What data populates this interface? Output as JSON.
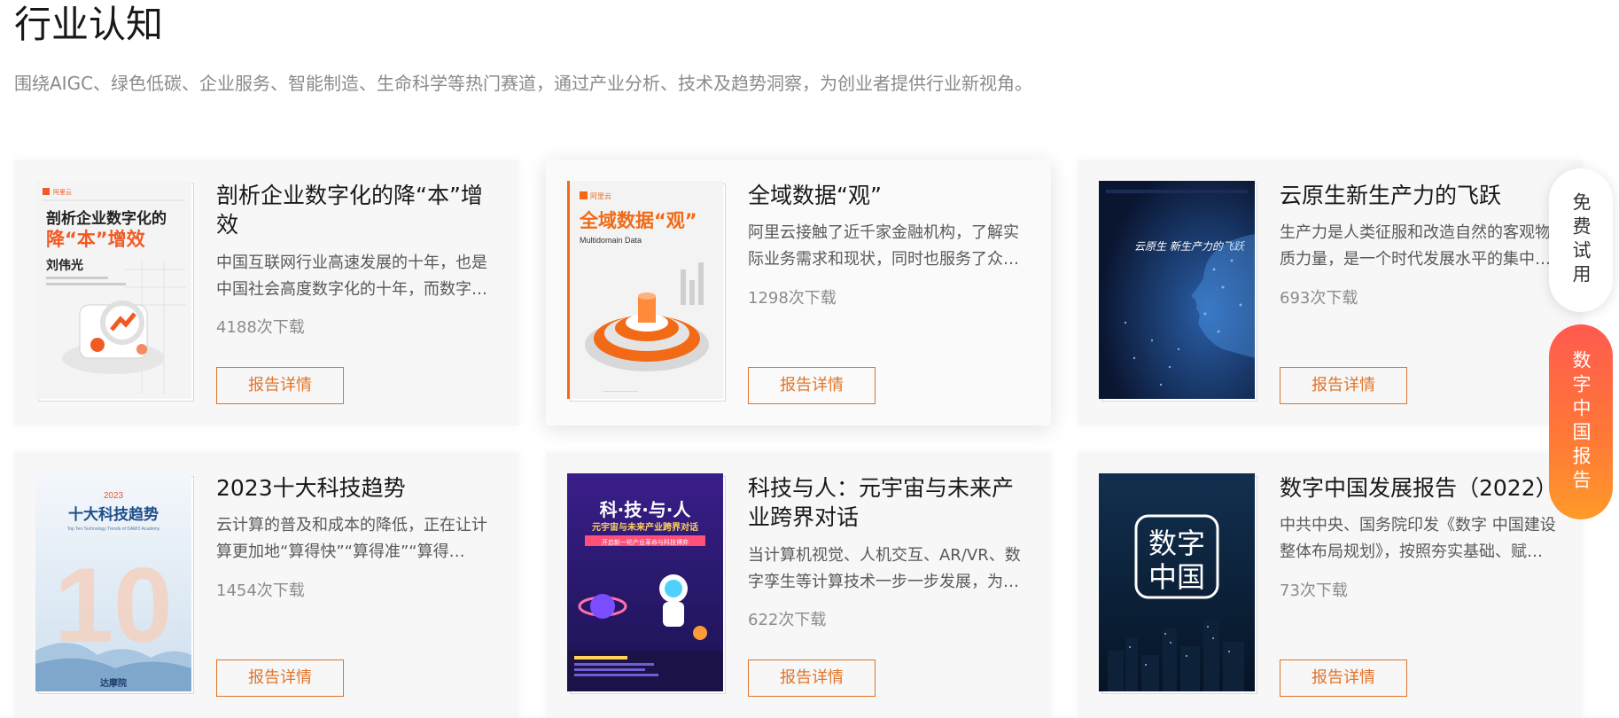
{
  "header": {
    "title": "行业认知",
    "subtitle": "围绕AIGC、绿色低碳、企业服务、智能制造、生命科学等热门赛道，通过产业分析、技术及趋势洞察，为创业者提供行业新视角。"
  },
  "cards": [
    {
      "title": "剖析企业数字化的降“本”增效",
      "desc": "中国互联网行业高速发展的十年，也是中国社会高度数字化的十年，而数字…",
      "downloads": "4188次下载",
      "button": "报告详情",
      "cover": {
        "logo": "阿里云",
        "line1": "剖析企业数字化的",
        "line2": "降“本”增效",
        "author": "刘伟光",
        "theme": "#f15a24"
      }
    },
    {
      "title": "全域数据“观”",
      "desc": "阿里云接触了近千家金融机构，了解实际业务需求和现状，同时也服务了众…",
      "downloads": "1298次下载",
      "button": "报告详情",
      "cover": {
        "logo": "阿里云",
        "headline": "全域数据“观”",
        "sub": "Multidomain Data",
        "theme": "#f26a16"
      }
    },
    {
      "title": "云原生新生产力的飞跃",
      "desc": "生产力是人类征服和改造自然的客观物质力量，是一个时代发展水平的集中…",
      "downloads": "693次下载",
      "button": "报告详情",
      "cover": {
        "headline": "云原生 新生产力的飞跃",
        "theme": "#0d1b3d"
      }
    },
    {
      "title": "2023十大科技趋势",
      "desc": "云计算的普及和成本的降低，正在让计算更加地“算得快”“算得准”“算得好”，…",
      "downloads": "1454次下载",
      "button": "报告详情",
      "cover": {
        "year": "2023",
        "headline": "十大科技趋势",
        "sub": "Top Ten Technology Trends of DAMO Academy",
        "number": "10",
        "brand": "达摩院",
        "theme": "#d9e6f2"
      }
    },
    {
      "title": "科技与人：元宇宙与未来产业跨界对话",
      "desc": "当计算机视觉、人机交互、AR/VR、数字孪生等计算技术一步一步发展，为…",
      "downloads": "622次下载",
      "button": "报告详情",
      "cover": {
        "headline": "科·技·与·人",
        "sub": "元宇宙与未来产业跨界对话",
        "tag": "开启新一轮产业革命与科技博弈",
        "theme": "#2b1a6e"
      }
    },
    {
      "title": "数字中国发展报告（2022）",
      "desc": "中共中央、国务院印发《数字 中国建设整体布局规划》，按照夯实基础、赋…",
      "downloads": "73次下载",
      "button": "报告详情",
      "cover": {
        "line1": "数字",
        "line2": "中国",
        "theme": "#0a1f3a"
      }
    }
  ],
  "side": {
    "free_trial": "免费试用",
    "report": "数字中国报告"
  },
  "colors": {
    "accent": "#e0742a",
    "side_gradient_top": "#ff5a4e",
    "side_gradient_bottom": "#ff9a2a"
  }
}
